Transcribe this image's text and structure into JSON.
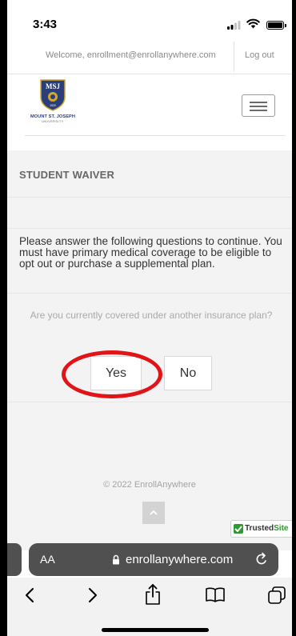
{
  "status_bar": {
    "time": "3:43"
  },
  "top_bar": {
    "welcome_text": "Welcome, enrollment@enrollanywhere.com",
    "logout_label": "Log out"
  },
  "logo": {
    "shield_text": "MSJ",
    "year": "1920",
    "name": "MOUNT ST. JOSEPH",
    "subtitle": "UNIVERSITY"
  },
  "page": {
    "section_title": "STUDENT WAIVER",
    "instructions": "Please answer the following questions to continue. You must have primary medical coverage to be eligible to opt out or purchase a supplemental plan.",
    "question": "Are you currently covered under another insurance plan?",
    "yes_label": "Yes",
    "no_label": "No"
  },
  "footer": {
    "copyright": "© 2022 EnrollAnywhere"
  },
  "badge": {
    "text_prefix": "Trusted",
    "text_suffix": "Site"
  },
  "browser": {
    "text_size_label": "AA",
    "url": "enrollanywhere.com"
  },
  "icons": {
    "status": [
      "signal-icon",
      "wifi-icon",
      "battery-icon"
    ],
    "toolbar": [
      "back-icon",
      "forward-icon",
      "share-icon",
      "bookmarks-icon",
      "tabs-icon"
    ]
  },
  "colors": {
    "annotation": "#e11418",
    "brand_navy": "#2a3e7a",
    "brand_gold": "#d4a72c",
    "trusted_green": "#2f9a2f"
  }
}
